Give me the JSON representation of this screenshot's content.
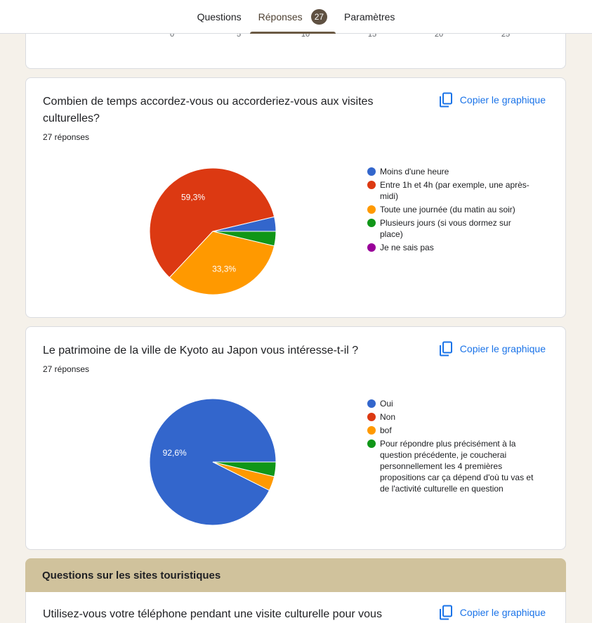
{
  "tabs": [
    {
      "label": "Questions"
    },
    {
      "label": "Réponses",
      "count": "27"
    },
    {
      "label": "Paramètres"
    }
  ],
  "top_card": {
    "ticks": [
      "0",
      "5",
      "10",
      "15",
      "20",
      "25"
    ]
  },
  "copy_label": "Copier le graphique",
  "cards": [
    {
      "title": "Combien de temps accordez-vous ou accorderiez-vous aux visites culturelles?",
      "responses": "27 réponses",
      "legend": [
        "Moins d'une heure",
        "Entre 1h et 4h (par exemple, une après-midi)",
        "Toute une journée (du matin au soir)",
        "Plusieurs jours (si vous dormez sur place)",
        "Je ne sais pas"
      ]
    },
    {
      "title": "Le patrimoine de la ville de Kyoto au Japon vous intéresse-t-il ?",
      "responses": "27 réponses",
      "legend": [
        "Oui",
        "Non",
        "bof",
        "Pour répondre plus précisément à la question précédente, je coucherai personnellement les 4 premières propositions car ça dépend d'où tu vas et de l'activité culturelle en question"
      ]
    }
  ],
  "section": {
    "title": "Questions sur les sites touristiques"
  },
  "next_card": {
    "title": "Utilisez-vous votre téléphone pendant une visite culturelle pour vous"
  },
  "chart_data": [
    {
      "type": "pie",
      "title": "Combien de temps accordez-vous ou accorderiez-vous aux visites culturelles?",
      "categories": [
        "Moins d'une heure",
        "Entre 1h et 4h (par exemple, une après-midi)",
        "Toute une journée (du matin au soir)",
        "Plusieurs jours (si vous dormez sur place)",
        "Je ne sais pas"
      ],
      "values": [
        3.7,
        59.3,
        33.3,
        3.7,
        0
      ],
      "labels": [
        "",
        "59,3%",
        "33,3%",
        "",
        ""
      ],
      "colors": [
        "#3366cc",
        "#dc3912",
        "#ff9900",
        "#109618",
        "#990099"
      ]
    },
    {
      "type": "pie",
      "title": "Le patrimoine de la ville de Kyoto au Japon vous intéresse-t-il ?",
      "categories": [
        "Oui",
        "Non",
        "bof",
        "Pour répondre plus précisément à la question précédente, je coucherai personnellement les 4 premières propositions car ça dépend d'où tu vas et de l'activité culturelle en question"
      ],
      "values": [
        92.6,
        0,
        3.7,
        3.7
      ],
      "labels": [
        "92,6%",
        "",
        "",
        ""
      ],
      "colors": [
        "#3366cc",
        "#dc3912",
        "#ff9900",
        "#109618"
      ]
    }
  ]
}
